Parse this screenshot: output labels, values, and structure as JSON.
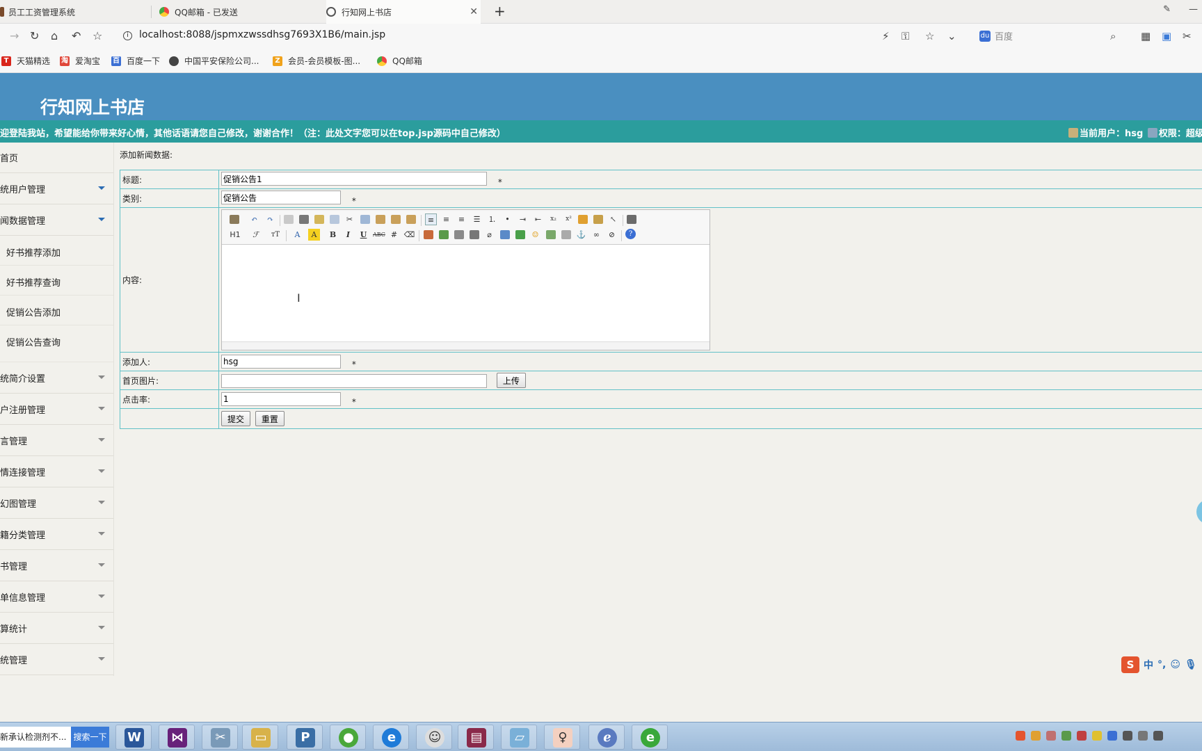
{
  "browser": {
    "tabs": [
      {
        "title": "员工工资管理系统",
        "active": false
      },
      {
        "title": "QQ邮箱 - 已发送",
        "active": false
      },
      {
        "title": "行知网上书店",
        "active": true
      }
    ],
    "url_host": "localhost",
    "url_path": ":8088/jspmxzwssdhsg7693X1B6/main.jsp",
    "search_engine": "百度",
    "bookmarks": [
      "天猫精选",
      "爱淘宝",
      "百度一下",
      "中国平安保险公司...",
      "会员-会员模板-图...",
      "QQ邮箱"
    ]
  },
  "site": {
    "title": "行知网上书店",
    "marquee": "迎登陆我站，希望能给你带来好心情，其他话语请您自己修改，谢谢合作！（注：此处文字您可以在top.jsp源码中自己修改）",
    "user_label": "当前用户：hsg",
    "role_label": "权限：超级"
  },
  "sidebar": {
    "items": [
      {
        "label": "首页",
        "expandable": false
      },
      {
        "label": "统用户管理",
        "expandable": true
      },
      {
        "label": "闻数据管理",
        "expandable": true,
        "active": true
      },
      {
        "label": "统简介设置",
        "expandable": true
      },
      {
        "label": "户注册管理",
        "expandable": true
      },
      {
        "label": "言管理",
        "expandable": true
      },
      {
        "label": "情连接管理",
        "expandable": true
      },
      {
        "label": "幻图管理",
        "expandable": true
      },
      {
        "label": "籍分类管理",
        "expandable": true
      },
      {
        "label": "书管理",
        "expandable": true
      },
      {
        "label": "单信息管理",
        "expandable": true
      },
      {
        "label": "算统计",
        "expandable": true
      },
      {
        "label": "统管理",
        "expandable": true
      }
    ],
    "subitems": [
      "好书推荐添加",
      "好书推荐查询",
      "促销公告添加",
      "促销公告查询"
    ]
  },
  "form": {
    "caption": "添加新闻数据:",
    "title_label": "标题:",
    "title_value": "促销公告1",
    "category_label": "类别:",
    "category_value": "促销公告",
    "content_label": "内容:",
    "author_label": "添加人:",
    "author_value": "hsg",
    "image_label": "首页图片:",
    "image_value": "",
    "upload_label": "上传",
    "clicks_label": "点击率:",
    "clicks_value": "1",
    "submit_label": "提交",
    "reset_label": "重置",
    "required_mark": "*"
  },
  "editor": {
    "heading_btn": "H1",
    "font_btn": "ℱ",
    "size_btn": "тT"
  },
  "ime": {
    "lang": "中",
    "punct": "°,"
  },
  "taskbar": {
    "search_text": "新承认检测剂不...",
    "search_btn": "搜索一下"
  },
  "colors": {
    "header": "#4a8fc0",
    "marquee": "#2b9d9d",
    "table_border": "#61c1c7"
  }
}
